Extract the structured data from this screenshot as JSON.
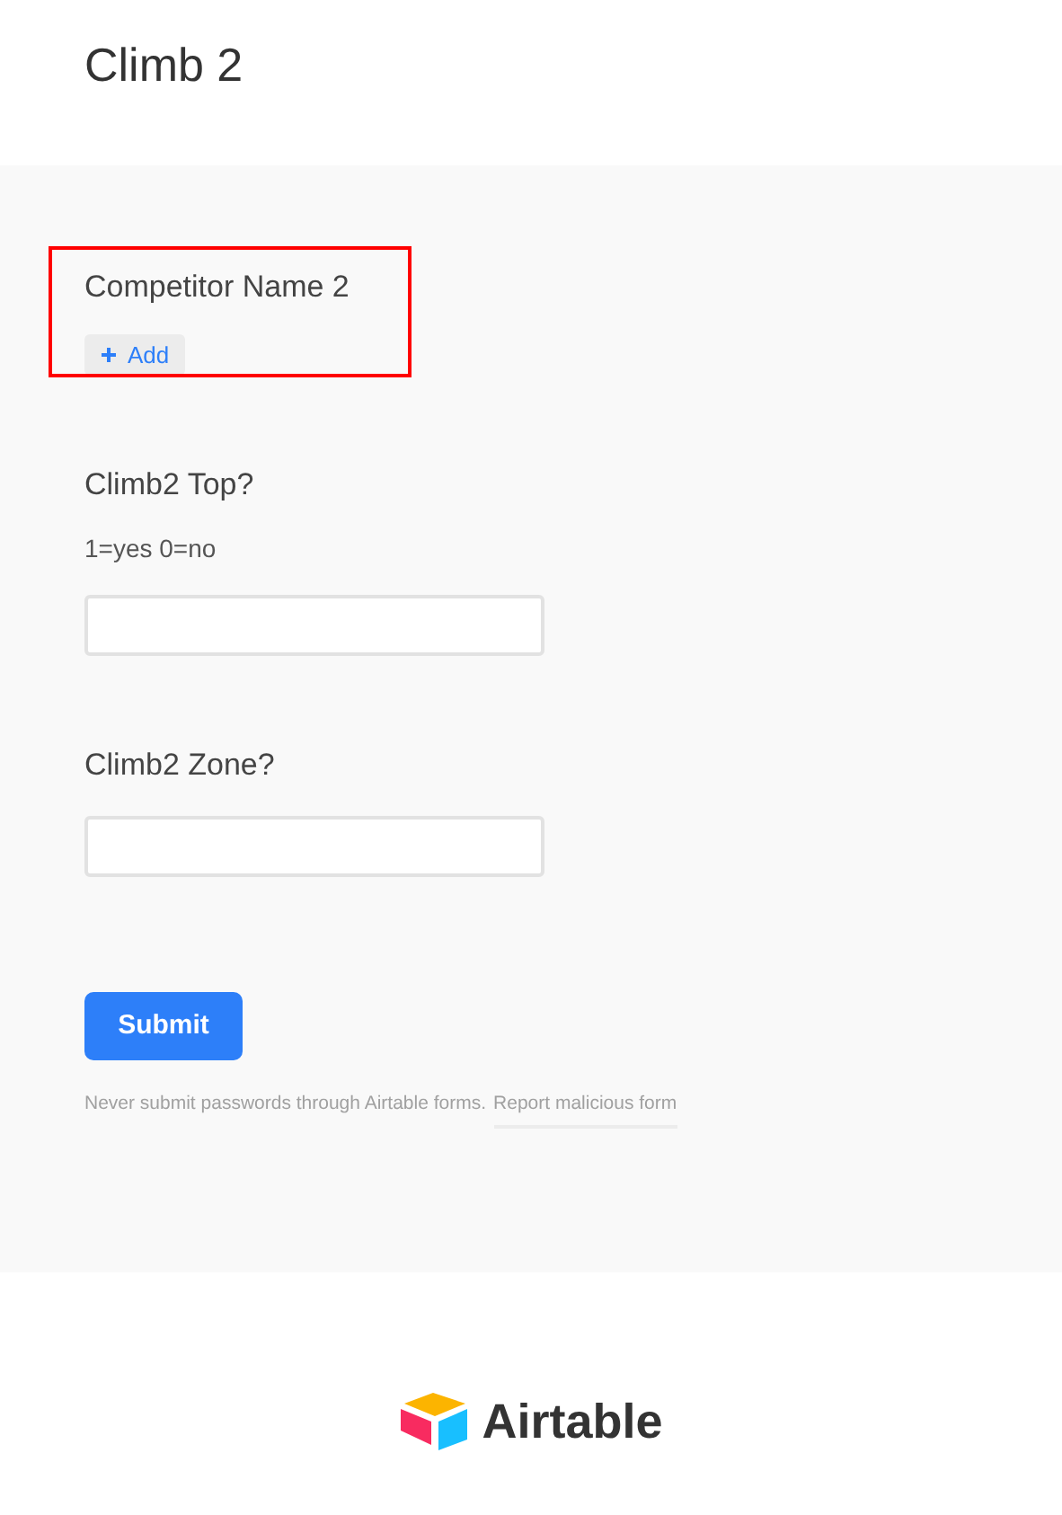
{
  "title": "Climb 2",
  "fields": [
    {
      "kind": "linked",
      "label": "Competitor Name 2",
      "button": "Add",
      "highlighted": true
    },
    {
      "kind": "input",
      "label": "Climb2 Top?",
      "description": "1=yes 0=no",
      "highlighted": false
    },
    {
      "kind": "input",
      "label": "Climb2 Zone?",
      "highlighted": false
    }
  ],
  "submit": "Submit",
  "notice": {
    "text": "Never submit passwords through Airtable forms.",
    "link": "Report malicious form"
  },
  "footer": {
    "brand": "Airtable"
  }
}
